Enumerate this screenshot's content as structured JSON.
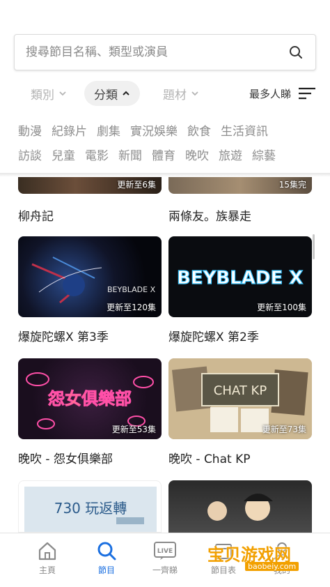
{
  "search": {
    "placeholder": "搜尋節目名稱、類型或演員",
    "icon": "search-icon"
  },
  "filters": {
    "category_label": "類別",
    "classification_label": "分類",
    "topic_label": "題材",
    "sort_label": "最多人睇"
  },
  "tags": {
    "row1": [
      "動漫",
      "紀錄片",
      "劇集",
      "實況娛樂",
      "飲食",
      "生活資訊"
    ],
    "row2": [
      "訪談",
      "兒童",
      "電影",
      "新聞",
      "體育",
      "晚吹",
      "旅遊",
      "綜藝"
    ]
  },
  "programs": [
    {
      "title": "柳舟記",
      "badge": "更新至6集"
    },
    {
      "title": "兩條友。族暴走",
      "badge": "15集完"
    },
    {
      "title": "爆旋陀螺X 第3季",
      "badge": "更新至120集",
      "art_text": "BEYBLADE X"
    },
    {
      "title": "爆旋陀螺X 第2季",
      "badge": "更新至100集",
      "art_text": "BEYBLADE X"
    },
    {
      "title": "晚吹 - 怨女俱樂部",
      "badge": "更新至53集",
      "art_text": "怨女俱樂部"
    },
    {
      "title": "晚吹 - Chat KP",
      "badge": "更新至73集",
      "art_text": "CHAT KP"
    },
    {
      "title": "",
      "badge": "",
      "art_text": "730 玩返轉"
    },
    {
      "title": "",
      "badge": ""
    }
  ],
  "bottom_nav": [
    {
      "label": "主頁",
      "icon": "home-icon"
    },
    {
      "label": "節目",
      "icon": "search-icon"
    },
    {
      "label": "一齊睇",
      "icon": "live-icon",
      "icon_text": "LIVE"
    },
    {
      "label": "節目表",
      "icon": "schedule-icon"
    },
    {
      "label": "我的",
      "icon": "profile-icon"
    }
  ],
  "watermark": {
    "text": "宝贝游戏网",
    "sub": "baobeiy.com"
  },
  "colors": {
    "accent": "#1a6fe0",
    "tag_text": "#8e8e8e",
    "inactive": "#b4b4b4"
  }
}
